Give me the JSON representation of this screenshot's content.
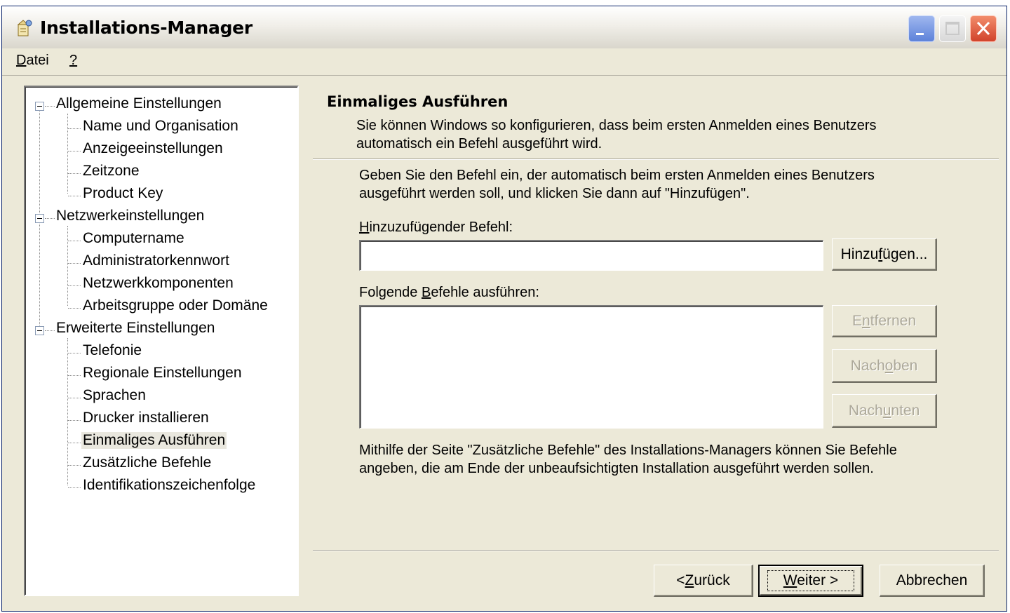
{
  "window": {
    "title": "Installations-Manager",
    "controls": [
      "minimize",
      "maximize",
      "close"
    ]
  },
  "menu": {
    "items": [
      {
        "label": "Datei",
        "mnemonic": "D"
      },
      {
        "label": "?",
        "mnemonic": "?"
      }
    ]
  },
  "tree": {
    "groups": [
      {
        "label": "Allgemeine Einstellungen",
        "expanded": true,
        "items": [
          "Name und Organisation",
          "Anzeigeeinstellungen",
          "Zeitzone",
          "Product Key"
        ]
      },
      {
        "label": "Netzwerkeinstellungen",
        "expanded": true,
        "items": [
          "Computername",
          "Administratorkennwort",
          "Netzwerkkomponenten",
          "Arbeitsgruppe oder Domäne"
        ]
      },
      {
        "label": "Erweiterte Einstellungen",
        "expanded": true,
        "items": [
          "Telefonie",
          "Regionale Einstellungen",
          "Sprachen",
          "Drucker installieren",
          "Einmaliges Ausführen",
          "Zusätzliche Befehle",
          "Identifikationszeichenfolge"
        ]
      }
    ],
    "selected": "Einmaliges Ausführen"
  },
  "page": {
    "title": "Einmaliges Ausführen",
    "description_line1": "Sie können Windows so konfigurieren, dass beim ersten Anmelden eines Benutzers",
    "description_line2": "automatisch ein Befehl ausgeführt wird.",
    "instruction_line1": "Geben Sie den Befehl ein, der automatisch beim ersten Anmelden eines Benutzers",
    "instruction_line2": "ausgeführt werden soll, und klicken Sie dann auf \"Hinzufügen\".",
    "command_label_pre": "",
    "command_label_mn": "H",
    "command_label_post": "inzuzufügender Befehl:",
    "command_value": "",
    "add_button_pre": "Hinzu",
    "add_button_mn": "f",
    "add_button_post": "ügen...",
    "list_label_pre": "Folgende ",
    "list_label_mn": "B",
    "list_label_post": "efehle ausführen:",
    "commands": [],
    "remove_pre": "E",
    "remove_mn": "n",
    "remove_post": "tfernen",
    "up_pre": "Nach ",
    "up_mn": "o",
    "up_post": "ben",
    "down_pre": "Nach ",
    "down_mn": "u",
    "down_post": "nten",
    "hint_line1": "Mithilfe der Seite \"Zusätzliche Befehle\" des Installations-Managers können Sie Befehle",
    "hint_line2": "angeben, die am Ende der unbeaufsichtigten Installation ausgeführt werden sollen."
  },
  "footer": {
    "back_pre": "< ",
    "back_mn": "Z",
    "back_post": "urück",
    "next_pre": "",
    "next_mn": "W",
    "next_post": "eiter >",
    "cancel": "Abbrechen"
  },
  "colors": {
    "window_bg": "#ece9d8",
    "close_button": "#d1432b",
    "minimize_button": "#5d82d9",
    "disabled_text": "#aca899"
  }
}
